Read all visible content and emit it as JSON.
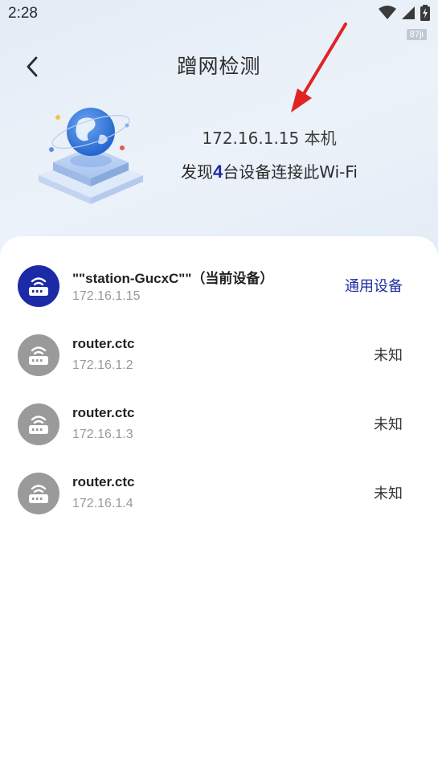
{
  "status_bar": {
    "time": "2:28",
    "tag": "87ji",
    "icons": [
      "wifi-icon",
      "signal-icon",
      "battery-charging-icon"
    ]
  },
  "header": {
    "title": "蹭网检测",
    "back_icon": "chevron-left-icon"
  },
  "hero": {
    "ip_line": "172.16.1.15 本机",
    "summary_prefix": "发现",
    "device_count": "4",
    "summary_suffix": "台设备连接此Wi-Fi",
    "illustration": "globe-on-platform-illustration"
  },
  "colors": {
    "accent": "#1f2ca0",
    "current_avatar": "#1c2aa6",
    "other_avatar": "#9a9a9a",
    "annotation_arrow": "#e02424"
  },
  "devices": [
    {
      "name": "\"\"station-GucxC\"\"（当前设备）",
      "ip": "172.16.1.15",
      "type": "通用设备",
      "icon": "router-icon"
    },
    {
      "name": "router.ctc",
      "ip": "172.16.1.2",
      "type": "未知",
      "icon": "router-icon"
    },
    {
      "name": "router.ctc",
      "ip": "172.16.1.3",
      "type": "未知",
      "icon": "router-icon"
    },
    {
      "name": "router.ctc",
      "ip": "172.16.1.4",
      "type": "未知",
      "icon": "router-icon"
    }
  ]
}
